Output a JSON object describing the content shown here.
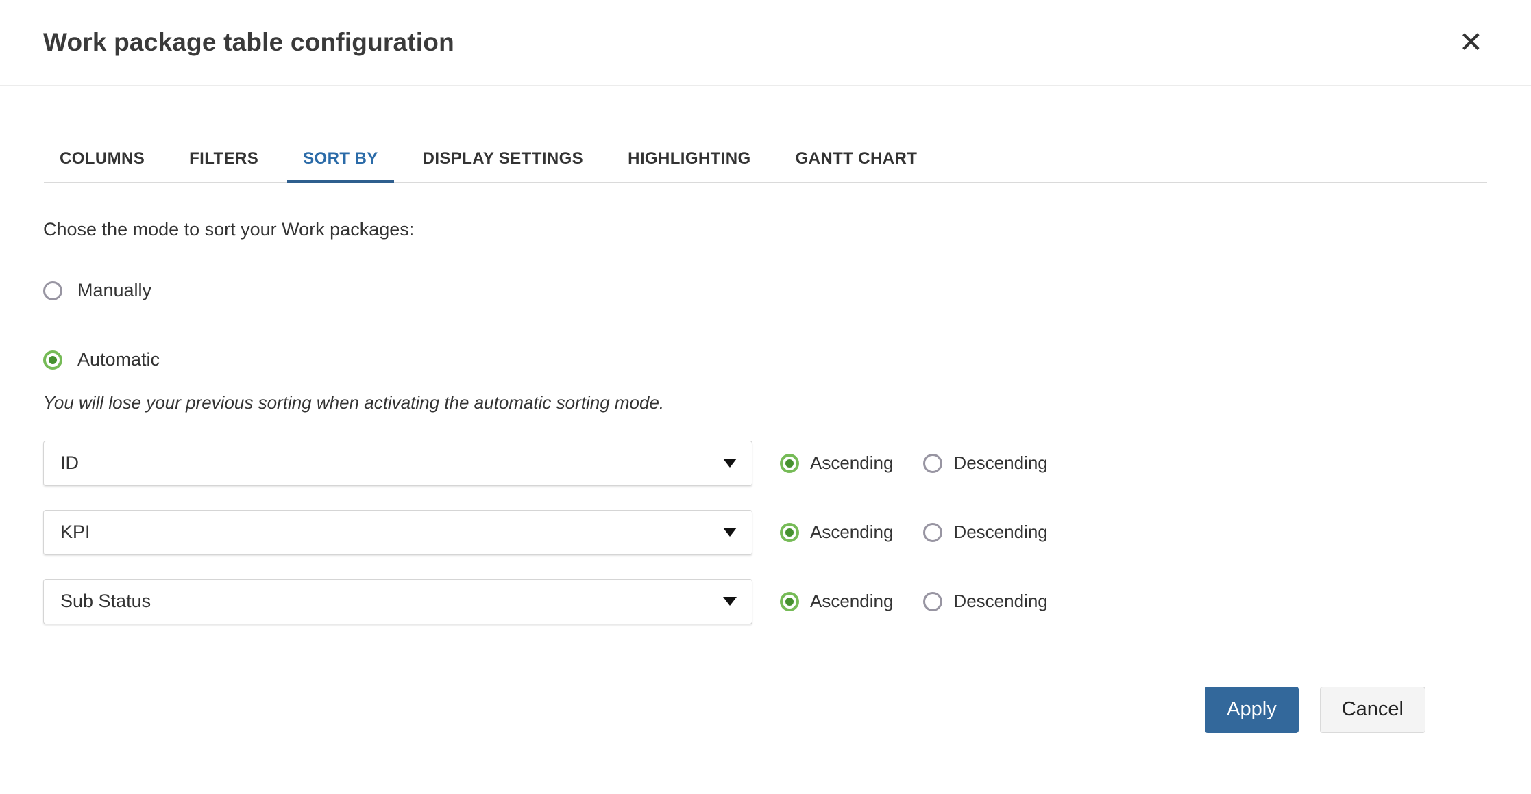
{
  "dialog": {
    "title": "Work package table configuration",
    "close_icon": "✕"
  },
  "tabs": {
    "items": [
      {
        "label": "COLUMNS"
      },
      {
        "label": "FILTERS"
      },
      {
        "label": "SORT BY",
        "active": true
      },
      {
        "label": "DISPLAY SETTINGS"
      },
      {
        "label": "HIGHLIGHTING"
      },
      {
        "label": "GANTT CHART"
      }
    ]
  },
  "sort": {
    "mode_prompt": "Chose the mode to sort your Work packages:",
    "modes": {
      "manually": {
        "label": "Manually",
        "selected": false
      },
      "automatic": {
        "label": "Automatic",
        "selected": true
      }
    },
    "warning": "You will lose your previous sorting when activating the automatic sorting mode.",
    "ascending_label": "Ascending",
    "descending_label": "Descending",
    "rows": [
      {
        "value": "ID",
        "ascending": true,
        "descending": false
      },
      {
        "value": "KPI",
        "ascending": true,
        "descending": false
      },
      {
        "value": "Sub Status",
        "ascending": true,
        "descending": false
      }
    ]
  },
  "footer": {
    "apply_label": "Apply",
    "cancel_label": "Cancel"
  },
  "colors": {
    "accent_tab": "#2b6ba8",
    "accent_tab_underline": "#2f5f8e",
    "apply_button_bg": "#33689b",
    "radio_selected_ring": "#76bb57",
    "radio_selected_dot": "#46912f",
    "radio_unselected_ring": "#9895a2"
  }
}
